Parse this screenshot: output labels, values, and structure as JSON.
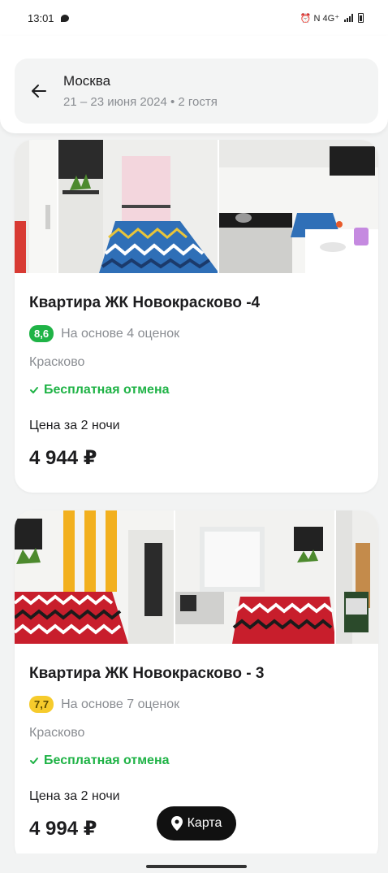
{
  "status_bar": {
    "time": "13:01",
    "indicators": "⏰ N 4G⁺"
  },
  "search": {
    "city": "Москва",
    "details": "21 – 23 июня 2024 • 2 гостя"
  },
  "listings": [
    {
      "title": "Квартира ЖК Новокрасково -4",
      "score": "8,6",
      "score_color": "#1fb346",
      "reviews": "На основе 4 оценок",
      "location": "Красково",
      "cancellation": "Бесплатная отмена",
      "price_label": "Цена за 2 ночи",
      "price": "4 944 ₽"
    },
    {
      "title": "Квартира ЖК Новокрасково - 3",
      "score": "7,7",
      "score_color": "#f6cb2c",
      "reviews": "На основе 7 оценок",
      "location": "Красково",
      "cancellation": "Бесплатная отмена",
      "price_label": "Цена за 2 ночи",
      "price": "4 994 ₽"
    }
  ],
  "map_button": {
    "label": "Карта"
  }
}
